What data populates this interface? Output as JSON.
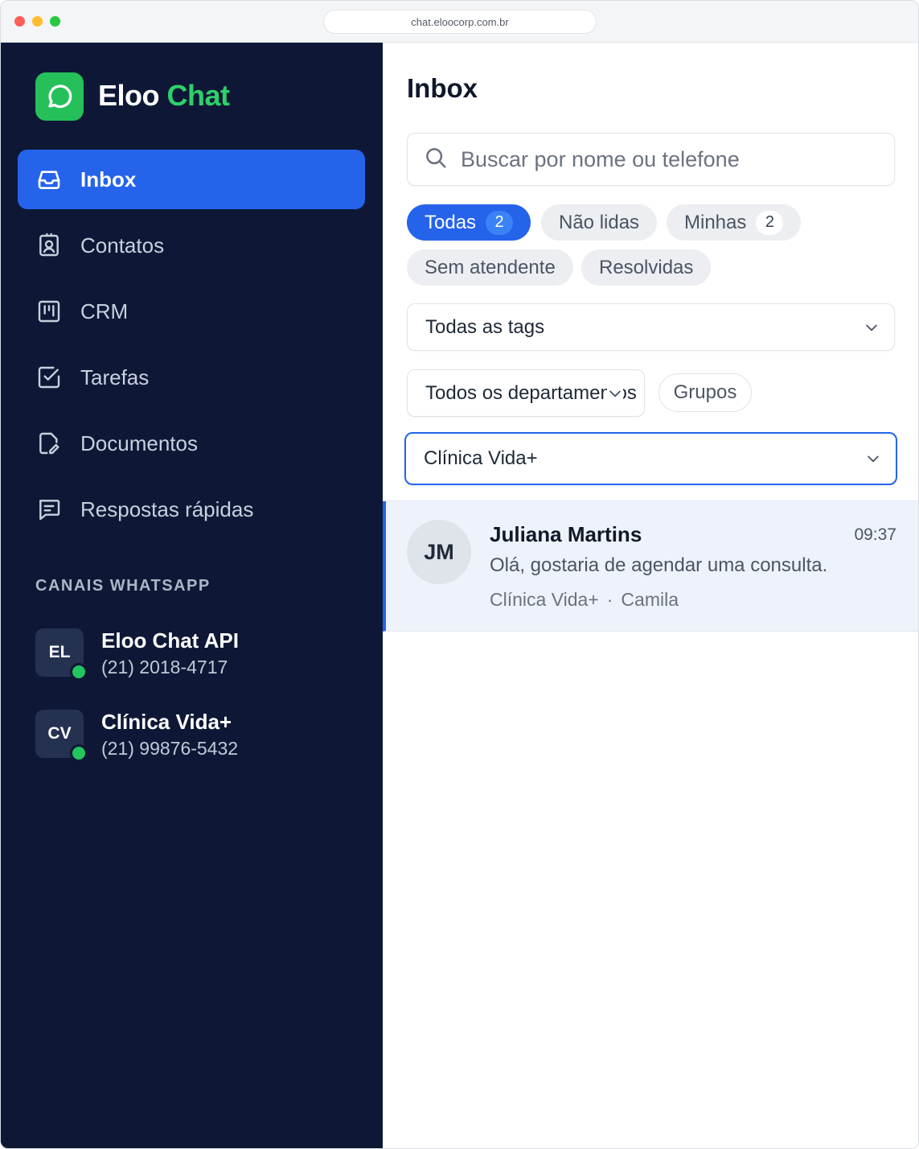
{
  "browser": {
    "url": "chat.eloocorp.com.br"
  },
  "brand": {
    "name_part1": "Eloo",
    "name_part2": "Chat"
  },
  "nav": [
    {
      "label": "Inbox",
      "icon": "inbox-icon",
      "active": true
    },
    {
      "label": "Contatos",
      "icon": "contact-card-icon"
    },
    {
      "label": "CRM",
      "icon": "kanban-icon"
    },
    {
      "label": "Tarefas",
      "icon": "checkbox-icon"
    },
    {
      "label": "Documentos",
      "icon": "document-edit-icon"
    },
    {
      "label": "Respostas rápidas",
      "icon": "message-square-icon"
    }
  ],
  "channels": {
    "title": "CANAIS WHATSAPP",
    "items": [
      {
        "initials": "EL",
        "name": "Eloo Chat API",
        "phone": "(21) 2018-4717",
        "online": true
      },
      {
        "initials": "CV",
        "name": "Clínica Vida+",
        "phone": "(21) 99876-5432",
        "online": true
      }
    ]
  },
  "inbox": {
    "title": "Inbox",
    "search_placeholder": "Buscar por nome ou telefone",
    "filters": [
      {
        "label": "Todas",
        "count": "2",
        "active": true
      },
      {
        "label": "Não lidas"
      },
      {
        "label": "Minhas",
        "count": "2"
      },
      {
        "label": "Sem atendente"
      },
      {
        "label": "Resolvidas"
      }
    ],
    "tags_select": "Todas as tags",
    "departments_select": "Todos os departamentos",
    "groups_button": "Grupos",
    "channel_select": "Clínica Vida+",
    "conversations": [
      {
        "initials": "JM",
        "name": "Juliana Martins",
        "time": "09:37",
        "preview": "Olá, gostaria de agendar uma consulta.",
        "channel": "Clínica Vida+",
        "separator": "·",
        "agent": "Camila"
      }
    ]
  },
  "colors": {
    "sidebar_bg": "#0e1836",
    "accent": "#2563eb",
    "brand_green": "#25c05a",
    "online": "#22c55e"
  }
}
